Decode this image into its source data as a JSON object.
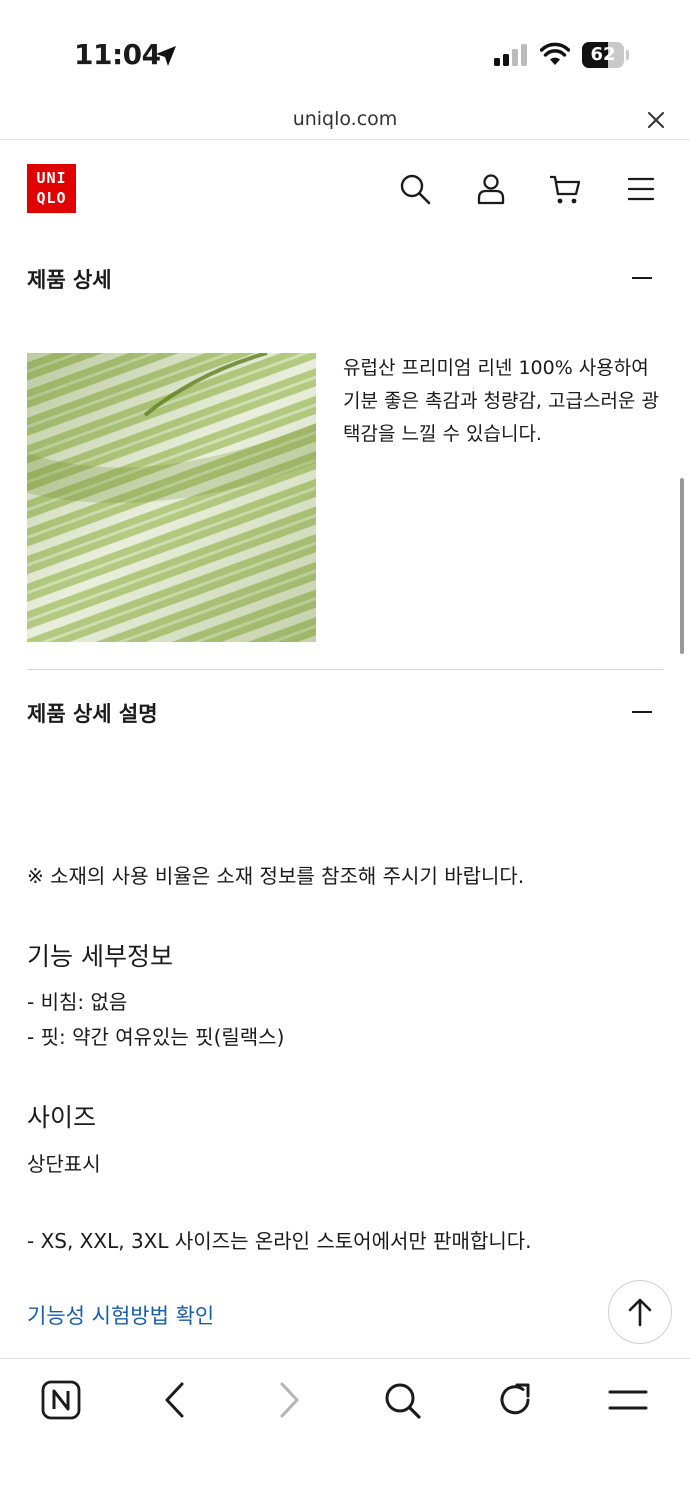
{
  "status_bar": {
    "time": "11:04",
    "battery": "62"
  },
  "browser": {
    "url": "uniqlo.com"
  },
  "header": {
    "logo_top": "UNI",
    "logo_bottom": "QLO",
    "logo_color": "#e00000"
  },
  "product_detail": {
    "title": "제품 상세",
    "description": "유럽산 프리미엄 리넨 100% 사용하여 기분 좋은 촉감과 청량감, 고급스러운 광택감을 느낄 수 있습니다."
  },
  "detail_description": {
    "title": "제품 상세 설명",
    "note": "※ 소재의 사용 비율은 소재 정보를 참조해 주시기 바랍니다.",
    "function_title": "기능 세부정보",
    "function_items": [
      "- 비침: 없음",
      "- 핏: 약간 여유있는 핏(릴랙스)"
    ],
    "size_title": "사이즈",
    "size_label": "상단표시",
    "size_note": "- XS, XXL, 3XL 사이즈는 온라인 스토어에서만 판매합니다.",
    "test_link": "기능성 시험방법 확인",
    "link_color": "#1a5ea8"
  },
  "icons": {
    "header": [
      "search-icon",
      "account-icon",
      "cart-icon",
      "menu-icon"
    ],
    "toolbar": [
      "naver-icon",
      "back-icon",
      "forward-icon",
      "search-icon",
      "reload-icon",
      "menu-icon"
    ]
  }
}
